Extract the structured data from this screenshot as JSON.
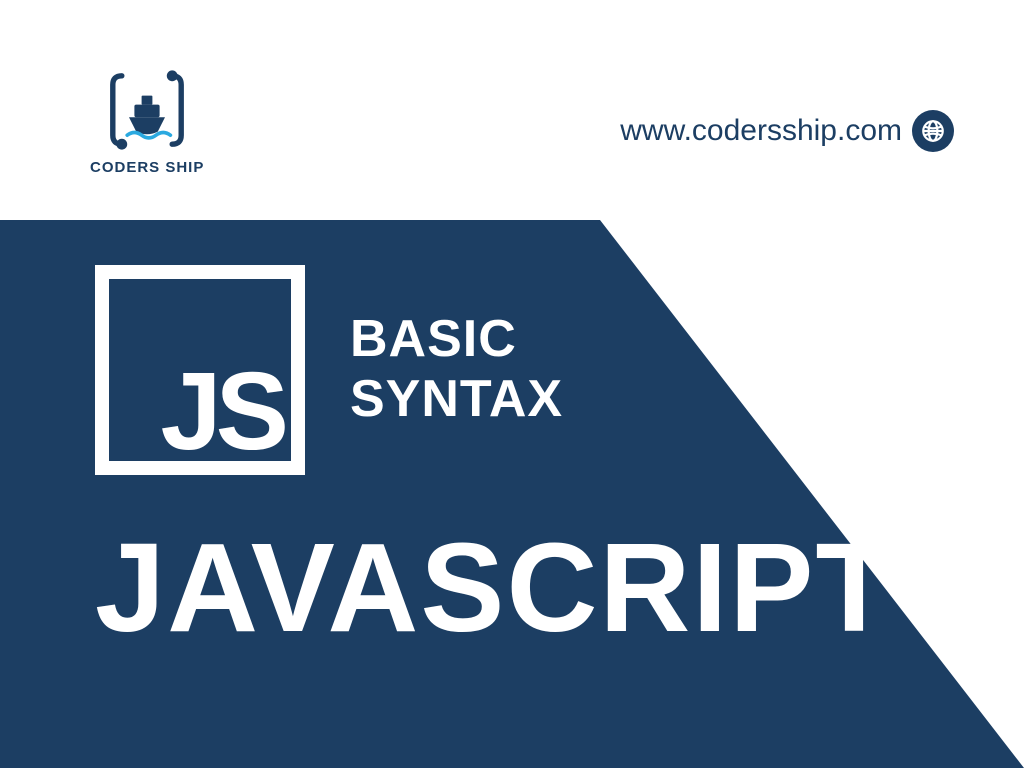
{
  "brand": {
    "name": "CODERS SHIP",
    "url": "www.codersship.com"
  },
  "logo": {
    "badge_text": "JS"
  },
  "content": {
    "subtitle_line1": "BASIC",
    "subtitle_line2": "SYNTAX",
    "title": "JAVASCRIPT"
  },
  "colors": {
    "primary": "#1c3e63",
    "foreground": "#ffffff"
  }
}
